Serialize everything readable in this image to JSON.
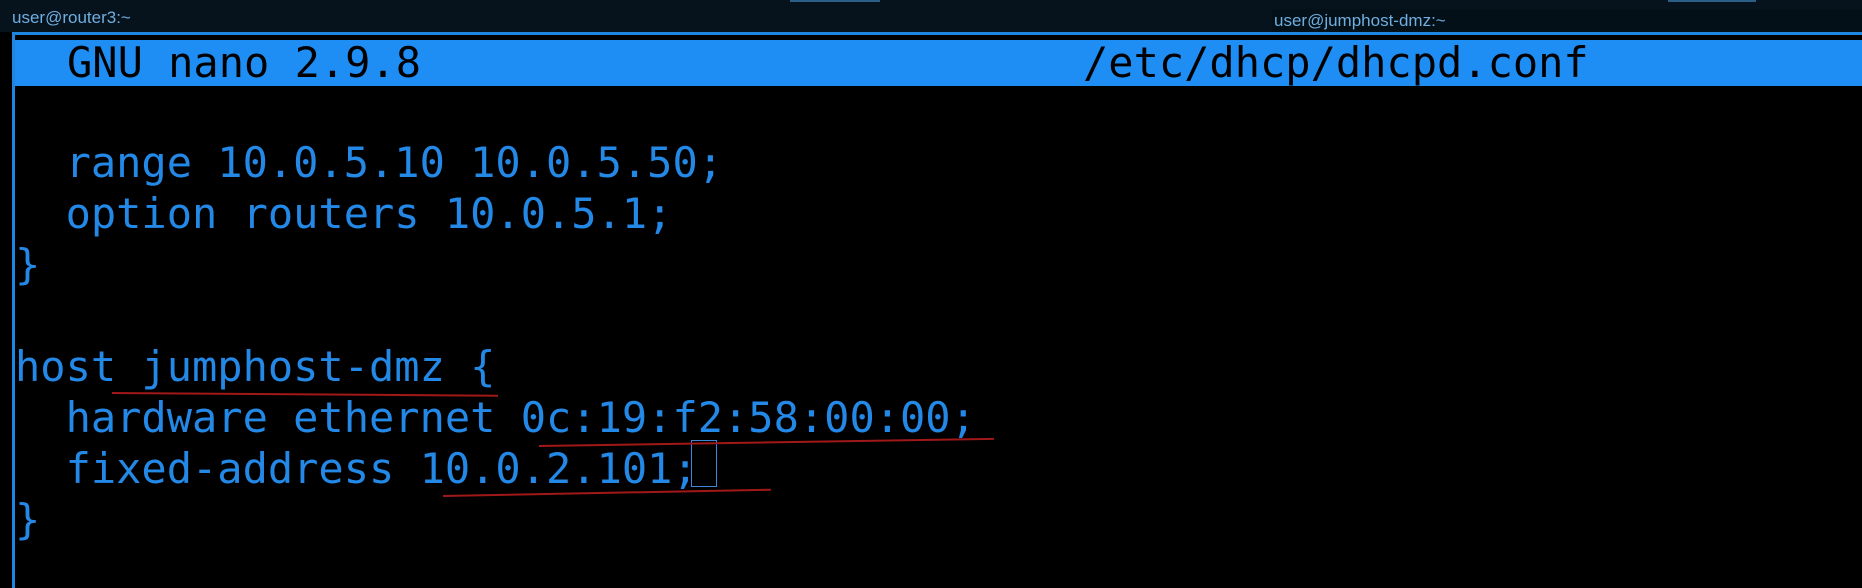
{
  "windows": {
    "left_title": "user@router3:~",
    "right_title": "user@jumphost-dmz:~"
  },
  "editor": {
    "app_version": "GNU nano 2.9.8",
    "filename": "/etc/dhcp/dhcpd.conf"
  },
  "file_lines": [
    "  range 10.0.5.10 10.0.5.50;",
    "  option routers 10.0.5.1;",
    "}",
    "",
    "host jumphost-dmz {",
    "  hardware ethernet 0c:19:f2:58:00:00;",
    "  fixed-address 10.0.2.101;",
    "}"
  ],
  "colors": {
    "text": "#2388e6",
    "header_bg": "#1e8ef5",
    "background": "#000000",
    "annotation": "#a01818"
  }
}
